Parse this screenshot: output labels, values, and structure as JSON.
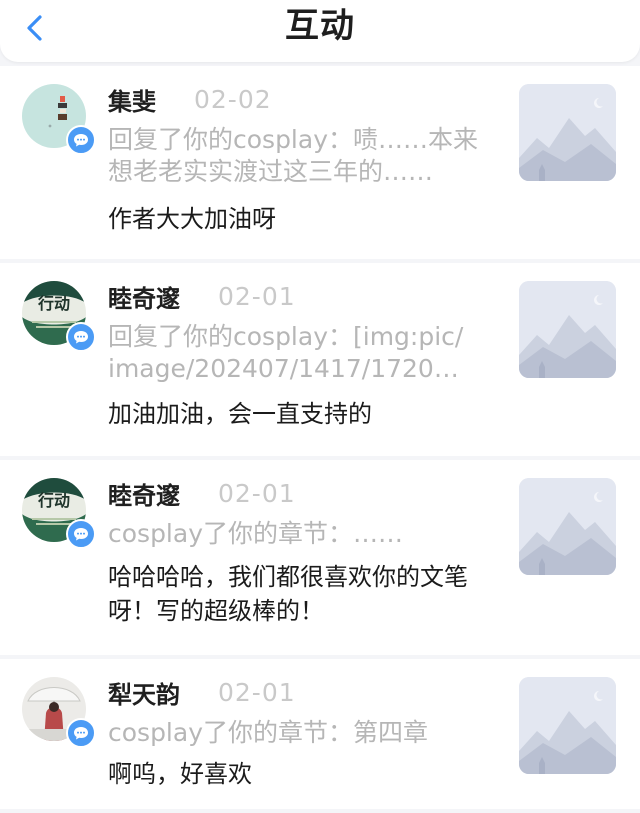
{
  "header": {
    "title": "互动",
    "back_icon": "chevron-left-icon",
    "accent": "#3a8ef6"
  },
  "items": [
    {
      "name": "集斐",
      "date": "02-02",
      "quote_line1": "回复了你的cosplay：啧……本来",
      "quote_line2": "想老老实实渡过这三年的……",
      "comment": "作者大大加油呀"
    },
    {
      "name": "睦奇邃",
      "date": "02-01",
      "avatar_text": "行动",
      "quote_line1": "回复了你的cosplay：[img:pic/",
      "quote_line2": "image/202407/1417/1720…",
      "comment": "加油加油，会一直支持的"
    },
    {
      "name": "睦奇邃",
      "date": "02-01",
      "avatar_text": "行动",
      "quote_line1": "cosplay了你的章节：……",
      "comment_line1": "哈哈哈哈，我们都很喜欢你的文笔",
      "comment_line2": "呀！写的超级棒的！"
    },
    {
      "name": "犁天韵",
      "date": "02-01",
      "quote_line1": "cosplay了你的章节：第四章",
      "comment": "啊呜，好喜欢"
    }
  ],
  "icons": {
    "badge": "comment-bubble-icon",
    "thumbnail": "image-placeholder-icon"
  }
}
